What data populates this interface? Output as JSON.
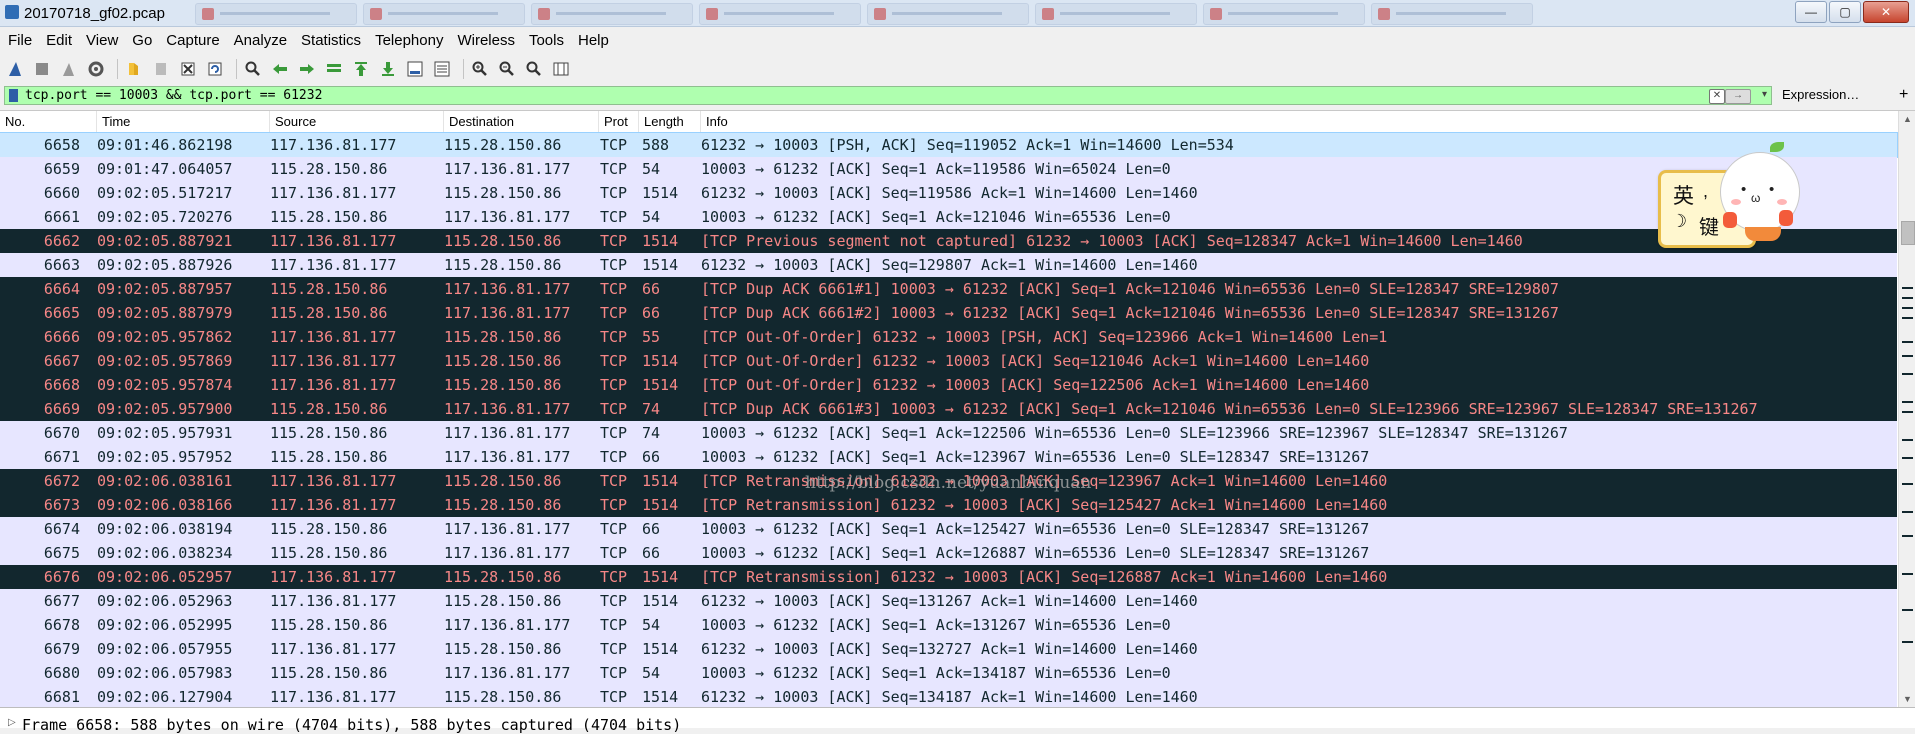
{
  "window": {
    "title": "20170718_gf02.pcap",
    "controls": {
      "minimize": "—",
      "maximize": "▢",
      "close": "✕"
    }
  },
  "menu": [
    "File",
    "Edit",
    "View",
    "Go",
    "Capture",
    "Analyze",
    "Statistics",
    "Telephony",
    "Wireless",
    "Tools",
    "Help"
  ],
  "filter": {
    "value": "tcp.port == 10003 && tcp.port == 61232",
    "expression_label": "Expression…",
    "plus_label": "+",
    "bg_color": "#afffaf"
  },
  "columns": [
    "No.",
    "Time",
    "Source",
    "Destination",
    "Prot",
    "Length",
    "Info"
  ],
  "colors": {
    "normal_bg": "#e7e6ff",
    "bad_bg": "#12272e",
    "bad_fg": "#f78787",
    "selected_bg": "#cce8ff"
  },
  "packets": [
    {
      "no": "6658",
      "time": "09:01:46.862198",
      "src": "117.136.81.177",
      "dst": "115.28.150.86",
      "proto": "TCP",
      "len": "588",
      "info": "61232 → 10003 [PSH, ACK] Seq=119052 Ack=1 Win=14600 Len=534",
      "style": "selected"
    },
    {
      "no": "6659",
      "time": "09:01:47.064057",
      "src": "115.28.150.86",
      "dst": "117.136.81.177",
      "proto": "TCP",
      "len": "54",
      "info": "10003 → 61232 [ACK] Seq=1 Ack=119586 Win=65024 Len=0",
      "style": "normal"
    },
    {
      "no": "6660",
      "time": "09:02:05.517217",
      "src": "117.136.81.177",
      "dst": "115.28.150.86",
      "proto": "TCP",
      "len": "1514",
      "info": "61232 → 10003 [ACK] Seq=119586 Ack=1 Win=14600 Len=1460",
      "style": "normal"
    },
    {
      "no": "6661",
      "time": "09:02:05.720276",
      "src": "115.28.150.86",
      "dst": "117.136.81.177",
      "proto": "TCP",
      "len": "54",
      "info": "10003 → 61232 [ACK] Seq=1 Ack=121046 Win=65536 Len=0",
      "style": "normal"
    },
    {
      "no": "6662",
      "time": "09:02:05.887921",
      "src": "117.136.81.177",
      "dst": "115.28.150.86",
      "proto": "TCP",
      "len": "1514",
      "info": "[TCP Previous segment not captured] 61232 → 10003 [ACK] Seq=128347 Ack=1 Win=14600 Len=1460",
      "style": "bad"
    },
    {
      "no": "6663",
      "time": "09:02:05.887926",
      "src": "117.136.81.177",
      "dst": "115.28.150.86",
      "proto": "TCP",
      "len": "1514",
      "info": "61232 → 10003 [ACK] Seq=129807 Ack=1 Win=14600 Len=1460",
      "style": "normal"
    },
    {
      "no": "6664",
      "time": "09:02:05.887957",
      "src": "115.28.150.86",
      "dst": "117.136.81.177",
      "proto": "TCP",
      "len": "66",
      "info": "[TCP Dup ACK 6661#1] 10003 → 61232 [ACK] Seq=1 Ack=121046 Win=65536 Len=0 SLE=128347 SRE=129807",
      "style": "bad"
    },
    {
      "no": "6665",
      "time": "09:02:05.887979",
      "src": "115.28.150.86",
      "dst": "117.136.81.177",
      "proto": "TCP",
      "len": "66",
      "info": "[TCP Dup ACK 6661#2] 10003 → 61232 [ACK] Seq=1 Ack=121046 Win=65536 Len=0 SLE=128347 SRE=131267",
      "style": "bad"
    },
    {
      "no": "6666",
      "time": "09:02:05.957862",
      "src": "117.136.81.177",
      "dst": "115.28.150.86",
      "proto": "TCP",
      "len": "55",
      "info": "[TCP Out-Of-Order] 61232 → 10003 [PSH, ACK] Seq=123966 Ack=1 Win=14600 Len=1",
      "style": "bad"
    },
    {
      "no": "6667",
      "time": "09:02:05.957869",
      "src": "117.136.81.177",
      "dst": "115.28.150.86",
      "proto": "TCP",
      "len": "1514",
      "info": "[TCP Out-Of-Order] 61232 → 10003 [ACK] Seq=121046 Ack=1 Win=14600 Len=1460",
      "style": "bad"
    },
    {
      "no": "6668",
      "time": "09:02:05.957874",
      "src": "117.136.81.177",
      "dst": "115.28.150.86",
      "proto": "TCP",
      "len": "1514",
      "info": "[TCP Out-Of-Order] 61232 → 10003 [ACK] Seq=122506 Ack=1 Win=14600 Len=1460",
      "style": "bad"
    },
    {
      "no": "6669",
      "time": "09:02:05.957900",
      "src": "115.28.150.86",
      "dst": "117.136.81.177",
      "proto": "TCP",
      "len": "74",
      "info": "[TCP Dup ACK 6661#3] 10003 → 61232 [ACK] Seq=1 Ack=121046 Win=65536 Len=0 SLE=123966 SRE=123967 SLE=128347 SRE=131267",
      "style": "bad"
    },
    {
      "no": "6670",
      "time": "09:02:05.957931",
      "src": "115.28.150.86",
      "dst": "117.136.81.177",
      "proto": "TCP",
      "len": "74",
      "info": "10003 → 61232 [ACK] Seq=1 Ack=122506 Win=65536 Len=0 SLE=123966 SRE=123967 SLE=128347 SRE=131267",
      "style": "normal"
    },
    {
      "no": "6671",
      "time": "09:02:05.957952",
      "src": "115.28.150.86",
      "dst": "117.136.81.177",
      "proto": "TCP",
      "len": "66",
      "info": "10003 → 61232 [ACK] Seq=1 Ack=123967 Win=65536 Len=0 SLE=128347 SRE=131267",
      "style": "normal"
    },
    {
      "no": "6672",
      "time": "09:02:06.038161",
      "src": "117.136.81.177",
      "dst": "115.28.150.86",
      "proto": "TCP",
      "len": "1514",
      "info": "[TCP Retransmission] 61232 → 10003 [ACK] Seq=123967 Ack=1 Win=14600 Len=1460",
      "style": "bad"
    },
    {
      "no": "6673",
      "time": "09:02:06.038166",
      "src": "117.136.81.177",
      "dst": "115.28.150.86",
      "proto": "TCP",
      "len": "1514",
      "info": "[TCP Retransmission] 61232 → 10003 [ACK] Seq=125427 Ack=1 Win=14600 Len=1460",
      "style": "bad"
    },
    {
      "no": "6674",
      "time": "09:02:06.038194",
      "src": "115.28.150.86",
      "dst": "117.136.81.177",
      "proto": "TCP",
      "len": "66",
      "info": "10003 → 61232 [ACK] Seq=1 Ack=125427 Win=65536 Len=0 SLE=128347 SRE=131267",
      "style": "normal"
    },
    {
      "no": "6675",
      "time": "09:02:06.038234",
      "src": "115.28.150.86",
      "dst": "117.136.81.177",
      "proto": "TCP",
      "len": "66",
      "info": "10003 → 61232 [ACK] Seq=1 Ack=126887 Win=65536 Len=0 SLE=128347 SRE=131267",
      "style": "normal"
    },
    {
      "no": "6676",
      "time": "09:02:06.052957",
      "src": "117.136.81.177",
      "dst": "115.28.150.86",
      "proto": "TCP",
      "len": "1514",
      "info": "[TCP Retransmission] 61232 → 10003 [ACK] Seq=126887 Ack=1 Win=14600 Len=1460",
      "style": "bad"
    },
    {
      "no": "6677",
      "time": "09:02:06.052963",
      "src": "117.136.81.177",
      "dst": "115.28.150.86",
      "proto": "TCP",
      "len": "1514",
      "info": "61232 → 10003 [ACK] Seq=131267 Ack=1 Win=14600 Len=1460",
      "style": "normal"
    },
    {
      "no": "6678",
      "time": "09:02:06.052995",
      "src": "115.28.150.86",
      "dst": "117.136.81.177",
      "proto": "TCP",
      "len": "54",
      "info": "10003 → 61232 [ACK] Seq=1 Ack=131267 Win=65536 Len=0",
      "style": "normal"
    },
    {
      "no": "6679",
      "time": "09:02:06.057955",
      "src": "117.136.81.177",
      "dst": "115.28.150.86",
      "proto": "TCP",
      "len": "1514",
      "info": "61232 → 10003 [ACK] Seq=132727 Ack=1 Win=14600 Len=1460",
      "style": "normal"
    },
    {
      "no": "6680",
      "time": "09:02:06.057983",
      "src": "115.28.150.86",
      "dst": "117.136.81.177",
      "proto": "TCP",
      "len": "54",
      "info": "10003 → 61232 [ACK] Seq=1 Ack=134187 Win=65536 Len=0",
      "style": "normal"
    },
    {
      "no": "6681",
      "time": "09:02:06.127904",
      "src": "117.136.81.177",
      "dst": "115.28.150.86",
      "proto": "TCP",
      "len": "1514",
      "info": "61232 → 10003 [ACK] Seq=134187 Ack=1 Win=14600 Len=1460",
      "style": "normal"
    }
  ],
  "detail": {
    "text": "Frame 6658: 588 bytes on wire (4704 bits), 588 bytes captured (4704 bits)"
  },
  "watermark": "http://blog.csdn.net/yuanbinquan",
  "ime": {
    "char1": "英",
    "char2": "键"
  }
}
